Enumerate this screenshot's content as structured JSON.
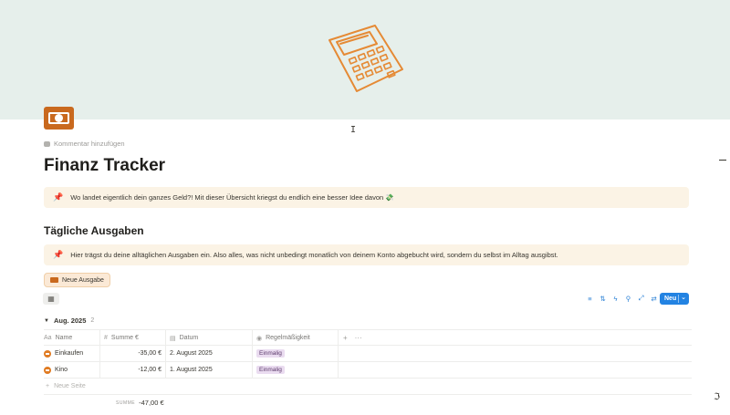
{
  "page": {
    "title": "Finanz Tracker",
    "comment_label": "Kommentar hinzufügen",
    "icon": "money-bill-icon",
    "cover_icon": "calculator-icon"
  },
  "callouts": [
    {
      "icon": "pushpin-icon",
      "text": "Wo landet eigentlich dein ganzes Geld?! Mit dieser Übersicht kriegst du endlich eine besser Idee davon 💸"
    },
    {
      "icon": "pushpin-icon",
      "text": "Hier trägst du deine alltäglichen Ausgaben ein. Also alles, was nicht unbedingt monatlich von deinem Konto abgebucht wird, sondern du selbst im Alltag ausgibst."
    }
  ],
  "section": {
    "heading": "Tägliche Ausgaben",
    "new_entry_label": "Neue Ausgabe"
  },
  "database": {
    "new_button_label": "Neu",
    "group": {
      "name": "Aug. 2025",
      "count": "2"
    },
    "columns": [
      {
        "icon": "text-icon",
        "label": "Name"
      },
      {
        "icon": "hash-icon",
        "label": "Summe €"
      },
      {
        "icon": "calendar-icon",
        "label": "Datum"
      },
      {
        "icon": "select-icon",
        "label": "Regelmäßigkeit"
      }
    ],
    "rows": [
      {
        "name": "Einkaufen",
        "summe": "-35,00 €",
        "datum": "2. August 2025",
        "regel": "Einmalig"
      },
      {
        "name": "Kino",
        "summe": "-12,00 €",
        "datum": "1. August 2025",
        "regel": "Einmalig"
      }
    ],
    "new_row_label": "Neue Seite",
    "sum_label": "SUMME",
    "sum_value": "-47,00 €"
  },
  "colors": {
    "cover_bg": "#e6efeb",
    "callout_bg": "#fbf3e5",
    "accent_orange": "#c9691e",
    "button_blue": "#2383e2",
    "tag_purple": "#eadcf0"
  }
}
